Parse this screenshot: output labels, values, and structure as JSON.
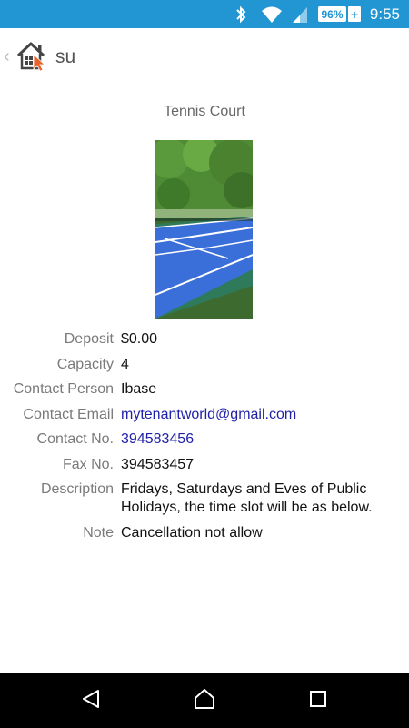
{
  "status_bar": {
    "battery_level": "96%",
    "battery_fraction": 0.96,
    "time": "9:55",
    "icons": [
      "bluetooth-icon",
      "wifi-icon",
      "cell-signal-icon",
      "battery-icon",
      "charging-plus-icon"
    ]
  },
  "app_bar": {
    "back_glyph": "‹",
    "title": "su"
  },
  "facility": {
    "title": "Tennis Court"
  },
  "details": [
    {
      "label": "Deposit",
      "value": "$0.00"
    },
    {
      "label": "Capacity",
      "value": "4"
    },
    {
      "label": "Contact Person",
      "value": "Ibase"
    },
    {
      "label": "Contact Email",
      "value": "mytenantworld@gmail.com"
    },
    {
      "label": "Contact No.",
      "value": "394583456"
    },
    {
      "label": "Fax No.",
      "value": "394583457"
    },
    {
      "label": "Description",
      "value": "Fridays, Saturdays and Eves of Public Holidays, the time slot will be as below."
    },
    {
      "label": "Note",
      "value": "Cancellation not allow"
    }
  ],
  "colors": {
    "status_bar": "#2196d3",
    "link": "#1f1fa8",
    "label": "#7a7a7a",
    "nav_bar": "#000000"
  },
  "nav": {
    "back_icon": "triangle-back-icon",
    "home_icon": "home-circle-icon",
    "recents_icon": "square-recents-icon"
  }
}
